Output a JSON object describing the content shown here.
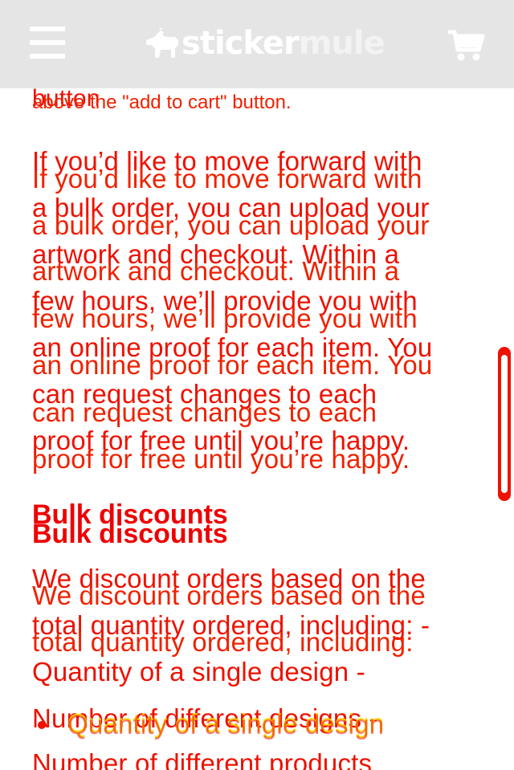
{
  "header": {
    "logo_word1": "sticker",
    "logo_word2": "mule",
    "menu_icon": "hamburger-menu-icon",
    "cart_icon": "shopping-cart-icon",
    "logo_icon": "mule-logo-icon",
    "background": "#e5e5e5"
  },
  "content": {
    "intro_partial_a": "button",
    "intro_partial_b": "above the \"add to cart\" button.",
    "paragraph1": [
      "If you’d like to move forward with",
      "a bulk order, you can upload your",
      "artwork and checkout. Within a",
      "few hours, we’ll provide you with",
      "an online proof for each item. You",
      "can request changes to each",
      "proof for free until you’re happy."
    ],
    "heading": "Bulk discounts",
    "paragraph2": [
      "We discount orders based on the",
      "total quantity ordered, including: -",
      "Quantity of a single design -",
      "Number of different designs -",
      "Number of different products"
    ],
    "paragraph2_alt": [
      "We discount orders based on the",
      "total quantity ordered, including:"
    ],
    "bullet_item": "Quantity of a single design",
    "text_color": "#ee1100",
    "ghost_color": "#ffd400"
  }
}
